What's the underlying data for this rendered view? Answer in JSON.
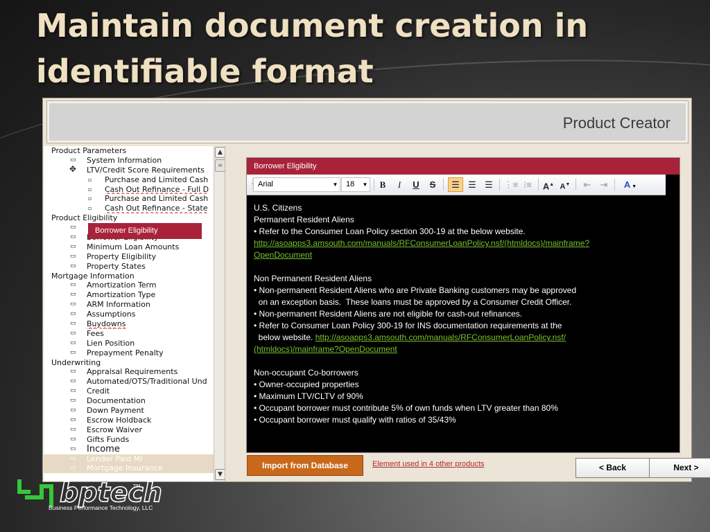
{
  "slide": {
    "title": "Maintain document creation in identifiable format"
  },
  "app": {
    "header_title": "Product Creator",
    "tree": [
      {
        "label": "Product Parameters",
        "level": 0
      },
      {
        "label": "System Information",
        "level": 1,
        "bullet": "▭"
      },
      {
        "label": "LTV/Credit Score Requirements",
        "level": 1,
        "bullet": "✥",
        "plus": true
      },
      {
        "label": "Purchase and Limited Cash",
        "level": 2,
        "bullet": "▫"
      },
      {
        "label": "Cash Out Refinance - Full D",
        "level": 2,
        "bullet": "▫",
        "wavy": true
      },
      {
        "label": "Purchase and Limited Cash",
        "level": 2,
        "bullet": "▫"
      },
      {
        "label": "Cash Out Refinance - State",
        "level": 2,
        "bullet": "▫",
        "wavy": true
      },
      {
        "label": "Product Eligibility",
        "level": 0
      },
      {
        "label": "",
        "level": 1,
        "bullet": "▭"
      },
      {
        "label": "Borrower Eligibility",
        "level": 1,
        "bullet": "▭"
      },
      {
        "label": "Minimum Loan Amounts",
        "level": 1,
        "bullet": "▭"
      },
      {
        "label": "Property Eligibility",
        "level": 1,
        "bullet": "▭"
      },
      {
        "label": "Property States",
        "level": 1,
        "bullet": "▭"
      },
      {
        "label": "Mortgage Information",
        "level": 0
      },
      {
        "label": "Amortization Term",
        "level": 1,
        "bullet": "▭"
      },
      {
        "label": "Amortization Type",
        "level": 1,
        "bullet": "▭"
      },
      {
        "label": "ARM Information",
        "level": 1,
        "bullet": "▭"
      },
      {
        "label": "Assumptions",
        "level": 1,
        "bullet": "▭"
      },
      {
        "label": "Buydowns",
        "level": 1,
        "bullet": "▭",
        "wavy": true
      },
      {
        "label": "Fees",
        "level": 1,
        "bullet": "▭"
      },
      {
        "label": "Lien Position",
        "level": 1,
        "bullet": "▭"
      },
      {
        "label": "Prepayment Penalty",
        "level": 1,
        "bullet": "▭"
      },
      {
        "label": "Underwriting",
        "level": 0
      },
      {
        "label": "Appraisal Requirements",
        "level": 1,
        "bullet": "▭"
      },
      {
        "label": "Automated/OTS/Traditional Und",
        "level": 1,
        "bullet": "▭"
      },
      {
        "label": "Credit",
        "level": 1,
        "bullet": "▭"
      },
      {
        "label": "Documentation",
        "level": 1,
        "bullet": "▭"
      },
      {
        "label": "Down Payment",
        "level": 1,
        "bullet": "▭"
      },
      {
        "label": "Escrow Holdback",
        "level": 1,
        "bullet": "▭"
      },
      {
        "label": "Escrow Waiver",
        "level": 1,
        "bullet": "▭"
      },
      {
        "label": "Gifts Funds",
        "level": 1,
        "bullet": "▭"
      },
      {
        "label": "Income",
        "level": 1,
        "bullet": "▭",
        "big": true
      },
      {
        "label": "Lender Paid MI",
        "level": 1,
        "bullet": "▭",
        "dim": true
      },
      {
        "label": "Mortgage Insurance",
        "level": 1,
        "bullet": "▭",
        "dim": true
      }
    ],
    "tree_selected": "Borrower Eligibility",
    "editor": {
      "heading": "Borrower Eligibility",
      "font_name": "Arial",
      "font_size": "18",
      "lines": [
        {
          "text": "U.S. Citizens"
        },
        {
          "text": "Permanent Resident Aliens"
        },
        {
          "text": "• Refer to the Consumer Loan Policy section 300-19 at the below website."
        },
        {
          "link": "http://asoapps3.amsouth.com/manuals/RFConsumerLoanPolicy.nsf/(htmldocs)/mainframe?"
        },
        {
          "link": "OpenDocument"
        },
        {
          "gap": true
        },
        {
          "text": "Non Permanent Resident Aliens"
        },
        {
          "text": "• Non-permanent Resident Aliens who are Private Banking customers may be approved"
        },
        {
          "text": "  on an exception basis.  These loans must be approved by a Consumer Credit Officer."
        },
        {
          "text": "• Non-permanent Resident Aliens are not eligible for cash-out refinances."
        },
        {
          "text": "• Refer to Consumer Loan Policy 300-19 for INS documentation requirements at the"
        },
        {
          "text": "  below website. ",
          "link": "http://asoapps3.amsouth.com/manuals/RFConsumerLoanPolicy.nsf/"
        },
        {
          "link": "(htmldocs)/mainframe?OpenDocument"
        },
        {
          "gap": true
        },
        {
          "text": "Non-occupant Co-borrowers"
        },
        {
          "text": "• Owner-occupied properties"
        },
        {
          "text": "• Maximum LTV/CLTV of 90%"
        },
        {
          "text": "• Occupant borrower must contribute 5% of own funds when LTV greater than 80%"
        },
        {
          "text": "• Occupant borrower must qualify with ratios of 35/43%"
        }
      ]
    },
    "import_label": "Import from Database",
    "element_link": "Element used in 4 other products",
    "back_label": "< Back",
    "next_label": "Next >"
  },
  "logo": {
    "wordmark": "bptech",
    "trademark": "TM",
    "subtitle": "Business Performance Technology, LLC"
  },
  "colors": {
    "accent_red": "#a8233a",
    "import_orange": "#c8681b",
    "link_green": "#79c22e",
    "logo_green": "#37c53c",
    "title_cream": "#efe0c2"
  }
}
